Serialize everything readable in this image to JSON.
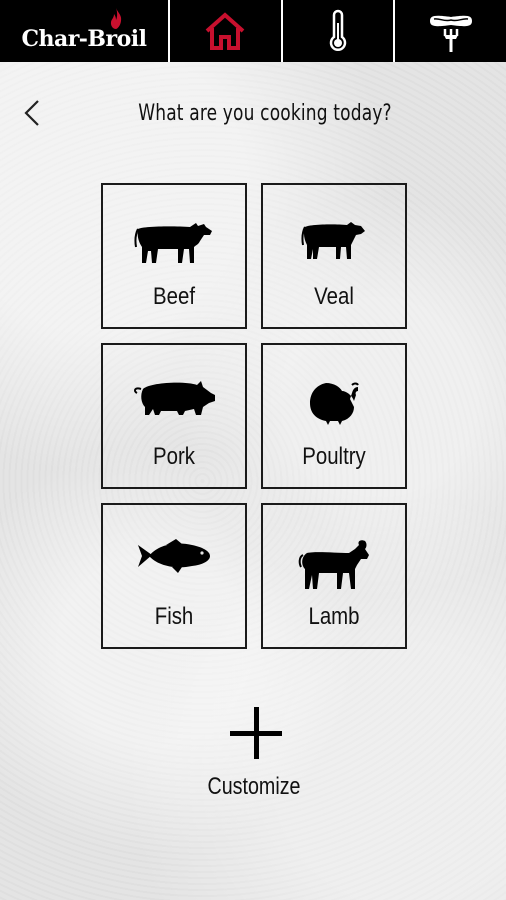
{
  "header": {
    "logo_text": "Char-Broil",
    "nav": [
      {
        "icon": "home-icon",
        "active": true
      },
      {
        "icon": "thermometer-icon",
        "active": false
      },
      {
        "icon": "sausage-fork-icon",
        "active": false
      }
    ],
    "accent_color": "#c8102e"
  },
  "page": {
    "back_icon": "chevron-left-icon",
    "title": "What are you cooking today?"
  },
  "categories": [
    {
      "label": "Beef",
      "icon": "cow-icon"
    },
    {
      "label": "Veal",
      "icon": "calf-icon"
    },
    {
      "label": "Pork",
      "icon": "pig-icon"
    },
    {
      "label": "Poultry",
      "icon": "turkey-icon"
    },
    {
      "label": "Fish",
      "icon": "fish-icon"
    },
    {
      "label": "Lamb",
      "icon": "goat-icon"
    }
  ],
  "customize": {
    "icon": "plus-icon",
    "label": "Customize"
  }
}
